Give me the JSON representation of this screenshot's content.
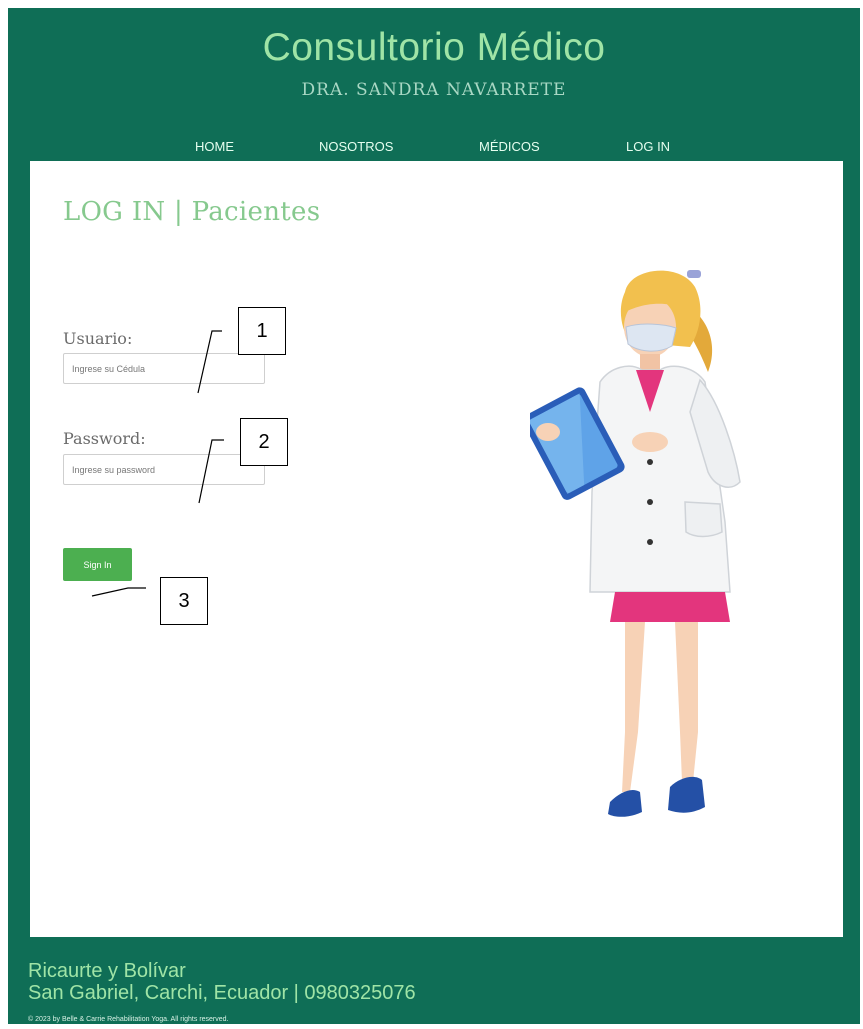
{
  "header": {
    "title": "Consultorio Médico",
    "subtitle": "DRA. SANDRA NAVARRETE"
  },
  "nav": {
    "items": [
      {
        "label": "HOME"
      },
      {
        "label": "NOSOTROS"
      },
      {
        "label": "MÉDICOS"
      },
      {
        "label": "LOG IN"
      }
    ]
  },
  "login": {
    "heading": "LOG IN | Pacientes",
    "username_label": "Usuario:",
    "username_placeholder": "Ingrese su Cédula",
    "username_value": "",
    "password_label": "Password:",
    "password_placeholder": "Ingrese su password",
    "password_value": "",
    "signin_label": "Sign In"
  },
  "callouts": [
    "1",
    "2",
    "3"
  ],
  "illustration": {
    "icon": "doctor-illustration"
  },
  "footer": {
    "address_line1": "Ricaurte y Bolívar",
    "address_line2": "San Gabriel, Carchi, Ecuador | 0980325076",
    "copyright": "© 2023 by Belle & Carrie Rehabilitation Yoga. All rights reserved."
  },
  "colors": {
    "brand_green": "#0f6e56",
    "accent_light_green": "#9fe4a6",
    "button_green": "#4caf50"
  }
}
